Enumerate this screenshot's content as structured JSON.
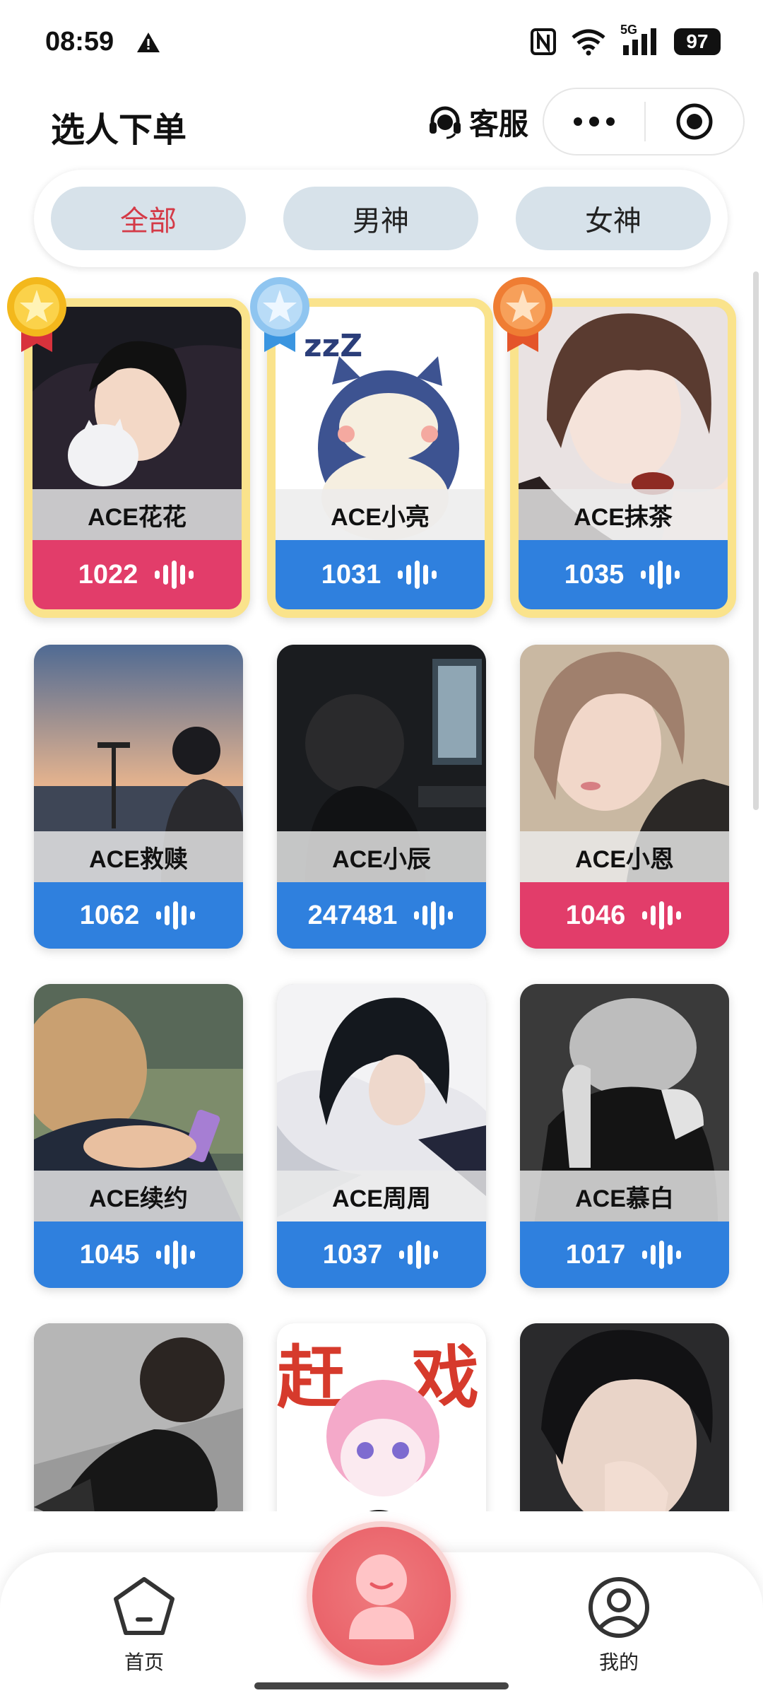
{
  "status_bar": {
    "time": "08:59",
    "network": "5G",
    "battery": "97",
    "icons": [
      "alert-icon",
      "nfc-icon",
      "wifi-icon",
      "signal-icon",
      "battery-icon"
    ]
  },
  "header": {
    "title": "选人下单",
    "service_label": "客服"
  },
  "filters": {
    "tabs": [
      {
        "label": "全部",
        "active": true
      },
      {
        "label": "男神",
        "active": false
      },
      {
        "label": "女神",
        "active": false
      }
    ]
  },
  "players": [
    {
      "name": "ACE花花",
      "price": "1022",
      "bar_color": "#e23d6a",
      "rank_medal": "gold-medal-icon"
    },
    {
      "name": "ACE小亮",
      "price": "1031",
      "bar_color": "#2f80de",
      "rank_medal": "silver-medal-icon"
    },
    {
      "name": "ACE抹茶",
      "price": "1035",
      "bar_color": "#2f80de",
      "rank_medal": "bronze-medal-icon"
    },
    {
      "name": "ACE救赎",
      "price": "1062",
      "bar_color": "#2f80de"
    },
    {
      "name": "ACE小辰",
      "price": "247481",
      "bar_color": "#2f80de"
    },
    {
      "name": "ACE小恩",
      "price": "1046",
      "bar_color": "#e23d6a"
    },
    {
      "name": "ACE续约",
      "price": "1045",
      "bar_color": "#2f80de"
    },
    {
      "name": "ACE周周",
      "price": "1037",
      "bar_color": "#2f80de"
    },
    {
      "name": "ACE慕白",
      "price": "1017",
      "bar_color": "#2f80de"
    }
  ],
  "bottom_nav": {
    "home_label": "首页",
    "mine_label": "我的"
  },
  "colors": {
    "accent_pink": "#e23d6a",
    "accent_blue": "#2f80de",
    "gold_frame": "#fae38c",
    "tab_bg": "#d7e2ea",
    "active_tab_text": "#d43a47"
  }
}
